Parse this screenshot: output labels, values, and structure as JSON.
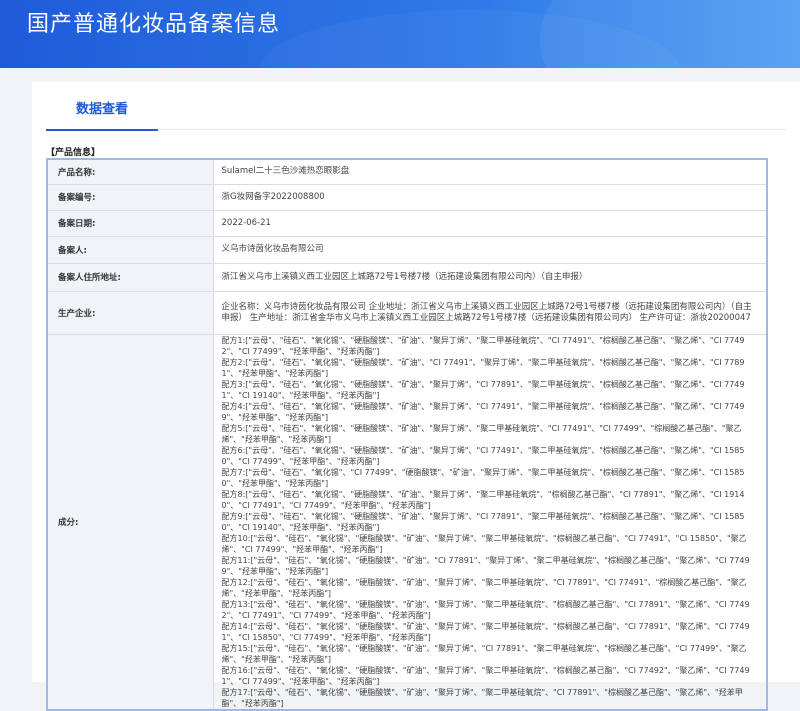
{
  "header": {
    "title": "国产普通化妆品备案信息"
  },
  "tabs": [
    {
      "label": "数据查看"
    }
  ],
  "section": {
    "title": "【产品信息】"
  },
  "rows": {
    "product_name": {
      "label": "产品名称:",
      "value": "Sulamel二十三色沙滩热恋眼影盘"
    },
    "record_no": {
      "label": "备案编号:",
      "value": "浙G妆网备字2022008800"
    },
    "record_date": {
      "label": "备案日期:",
      "value": "2022-06-21"
    },
    "filer": {
      "label": "备案人:",
      "value": "义乌市诗茵化妆品有限公司"
    },
    "filer_address": {
      "label": "备案人住所地址:",
      "value": "浙江省义乌市上溪镇义西工业园区上城路72号1号楼7楼（远拓建设集团有限公司内）（自主申报）"
    },
    "manufacturer": {
      "label": "生产企业:",
      "value": "企业名称：义乌市诗茵化妆品有限公司 企业地址：浙江省义乌市上溪镇义西工业园区上城路72号1号楼7楼（远拓建设集团有限公司内）（自主申报） 生产地址：浙江省金华市义乌市上溪镇义西工业园区上城路72号1号楼7楼（远拓建设集团有限公司内） 生产许可证：浙妆20200047"
    },
    "ingredients": {
      "label": "成分:"
    }
  },
  "formulas": [
    "配方1:[\"云母\"、\"硅石\"、\"氧化锡\"、\"硬脂酸镁\"、\"矿油\"、\"聚异丁烯\"、\"聚二甲基硅氧烷\"、\"CI 77491\"、\"棕榈酸乙基己酯\"、\"聚乙烯\"、\"CI 77492\"、\"CI 77499\"、\"羟苯甲酯\"、\"羟苯丙酯\"]",
    "配方2:[\"云母\"、\"硅石\"、\"氧化锡\"、\"硬脂酸镁\"、\"矿油\"、\"CI 77491\"、\"聚异丁烯\"、\"聚二甲基硅氧烷\"、\"棕榈酸乙基己酯\"、\"聚乙烯\"、\"CI 77891\"、\"羟苯甲酯\"、\"羟苯丙酯\"]",
    "配方3:[\"云母\"、\"硅石\"、\"氧化锡\"、\"硬脂酸镁\"、\"矿油\"、\"聚异丁烯\"、\"CI 77891\"、\"聚二甲基硅氧烷\"、\"棕榈酸乙基己酯\"、\"聚乙烯\"、\"CI 77491\"、\"CI 19140\"、\"羟苯甲酯\"、\"羟苯丙酯\"]",
    "配方4:[\"云母\"、\"硅石\"、\"氧化锡\"、\"硬脂酸镁\"、\"矿油\"、\"聚异丁烯\"、\"CI 77491\"、\"聚二甲基硅氧烷\"、\"棕榈酸乙基己酯\"、\"聚乙烯\"、\"CI 77499\"、\"羟苯甲酯\"、\"羟苯丙酯\"]",
    "配方5:[\"云母\"、\"硅石\"、\"氧化锡\"、\"硬脂酸镁\"、\"矿油\"、\"聚异丁烯\"、\"聚二甲基硅氧烷\"、\"CI 77491\"、\"CI 77499\"、\"棕榈酸乙基己酯\"、\"聚乙烯\"、\"羟苯甲酯\"、\"羟苯丙酯\"]",
    "配方6:[\"云母\"、\"硅石\"、\"氧化锡\"、\"硬脂酸镁\"、\"矿油\"、\"聚异丁烯\"、\"CI 77491\"、\"聚二甲基硅氧烷\"、\"棕榈酸乙基己酯\"、\"聚乙烯\"、\"CI 15850\"、\"CI 77499\"、\"羟苯甲酯\"、\"羟苯丙酯\"]",
    "配方7:[\"云母\"、\"硅石\"、\"氧化锡\"、\"CI 77499\"、\"硬脂酸镁\"、\"矿油\"、\"聚异丁烯\"、\"聚二甲基硅氧烷\"、\"棕榈酸乙基己酯\"、\"聚乙烯\"、\"CI 15850\"、\"羟苯甲酯\"、\"羟苯丙酯\"]",
    "配方8:[\"云母\"、\"硅石\"、\"氧化锡\"、\"硬脂酸镁\"、\"矿油\"、\"聚异丁烯\"、\"聚二甲基硅氧烷\"、\"棕榈酸乙基己酯\"、\"CI 77891\"、\"聚乙烯\"、\"CI 19140\"、\"CI 77491\"、\"CI 77499\"、\"羟苯甲酯\"、\"羟苯丙酯\"]",
    "配方9:[\"云母\"、\"硅石\"、\"氧化锡\"、\"硬脂酸镁\"、\"矿油\"、\"聚异丁烯\"、\"CI 77891\"、\"聚二甲基硅氧烷\"、\"棕榈酸乙基己酯\"、\"聚乙烯\"、\"CI 15850\"、\"CI 19140\"、\"羟苯甲酯\"、\"羟苯丙酯\"]",
    "配方10:[\"云母\"、\"硅石\"、\"氧化锡\"、\"硬脂酸镁\"、\"矿油\"、\"聚异丁烯\"、\"聚二甲基硅氧烷\"、\"棕榈酸乙基己酯\"、\"CI 77491\"、\"CI 15850\"、\"聚乙烯\"、\"CI 77499\"、\"羟苯甲酯\"、\"羟苯丙酯\"]",
    "配方11:[\"云母\"、\"硅石\"、\"氧化锡\"、\"硬脂酸镁\"、\"矿油\"、\"CI 77891\"、\"聚异丁烯\"、\"聚二甲基硅氧烷\"、\"棕榈酸乙基己酯\"、\"聚乙烯\"、\"CI 77499\"、\"羟苯甲酯\"、\"羟苯丙酯\"]",
    "配方12:[\"云母\"、\"硅石\"、\"氧化锡\"、\"硬脂酸镁\"、\"矿油\"、\"聚异丁烯\"、\"聚二甲基硅氧烷\"、\"CI 77891\"、\"CI 77491\"、\"棕榈酸乙基己酯\"、\"聚乙烯\"、\"羟苯甲酯\"、\"羟苯丙酯\"]",
    "配方13:[\"云母\"、\"硅石\"、\"氧化锡\"、\"硬脂酸镁\"、\"矿油\"、\"聚异丁烯\"、\"聚二甲基硅氧烷\"、\"棕榈酸乙基己酯\"、\"CI 77891\"、\"聚乙烯\"、\"CI 77492\"、\"CI 77491\"、\"CI 77499\"、\"羟苯甲酯\"、\"羟苯丙酯\"]",
    "配方14:[\"云母\"、\"硅石\"、\"氧化锡\"、\"硬脂酸镁\"、\"矿油\"、\"聚异丁烯\"、\"聚二甲基硅氧烷\"、\"棕榈酸乙基己酯\"、\"CI 77891\"、\"聚乙烯\"、\"CI 77491\"、\"CI 15850\"、\"CI 77499\"、\"羟苯甲酯\"、\"羟苯丙酯\"]",
    "配方15:[\"云母\"、\"硅石\"、\"氧化锡\"、\"硬脂酸镁\"、\"矿油\"、\"聚异丁烯\"、\"CI 77891\"、\"聚二甲基硅氧烷\"、\"棕榈酸乙基己酯\"、\"CI 77499\"、\"聚乙烯\"、\"羟苯甲酯\"、\"羟苯丙酯\"]",
    "配方16:[\"云母\"、\"硅石\"、\"氧化锡\"、\"硬脂酸镁\"、\"矿油\"、\"聚异丁烯\"、\"聚二甲基硅氧烷\"、\"棕榈酸乙基己酯\"、\"CI 77492\"、\"聚乙烯\"、\"CI 77491\"、\"CI 77499\"、\"羟苯甲酯\"、\"羟苯丙酯\"]",
    "配方17:[\"云母\"、\"硅石\"、\"氧化锡\"、\"硬脂酸镁\"、\"矿油\"、\"聚异丁烯\"、\"聚二甲基硅氧烷\"、\"CI 77891\"、\"棕榈酸乙基己酯\"、\"聚乙烯\"、\"羟苯甲酯\"、\"羟苯丙酯\"]"
  ]
}
